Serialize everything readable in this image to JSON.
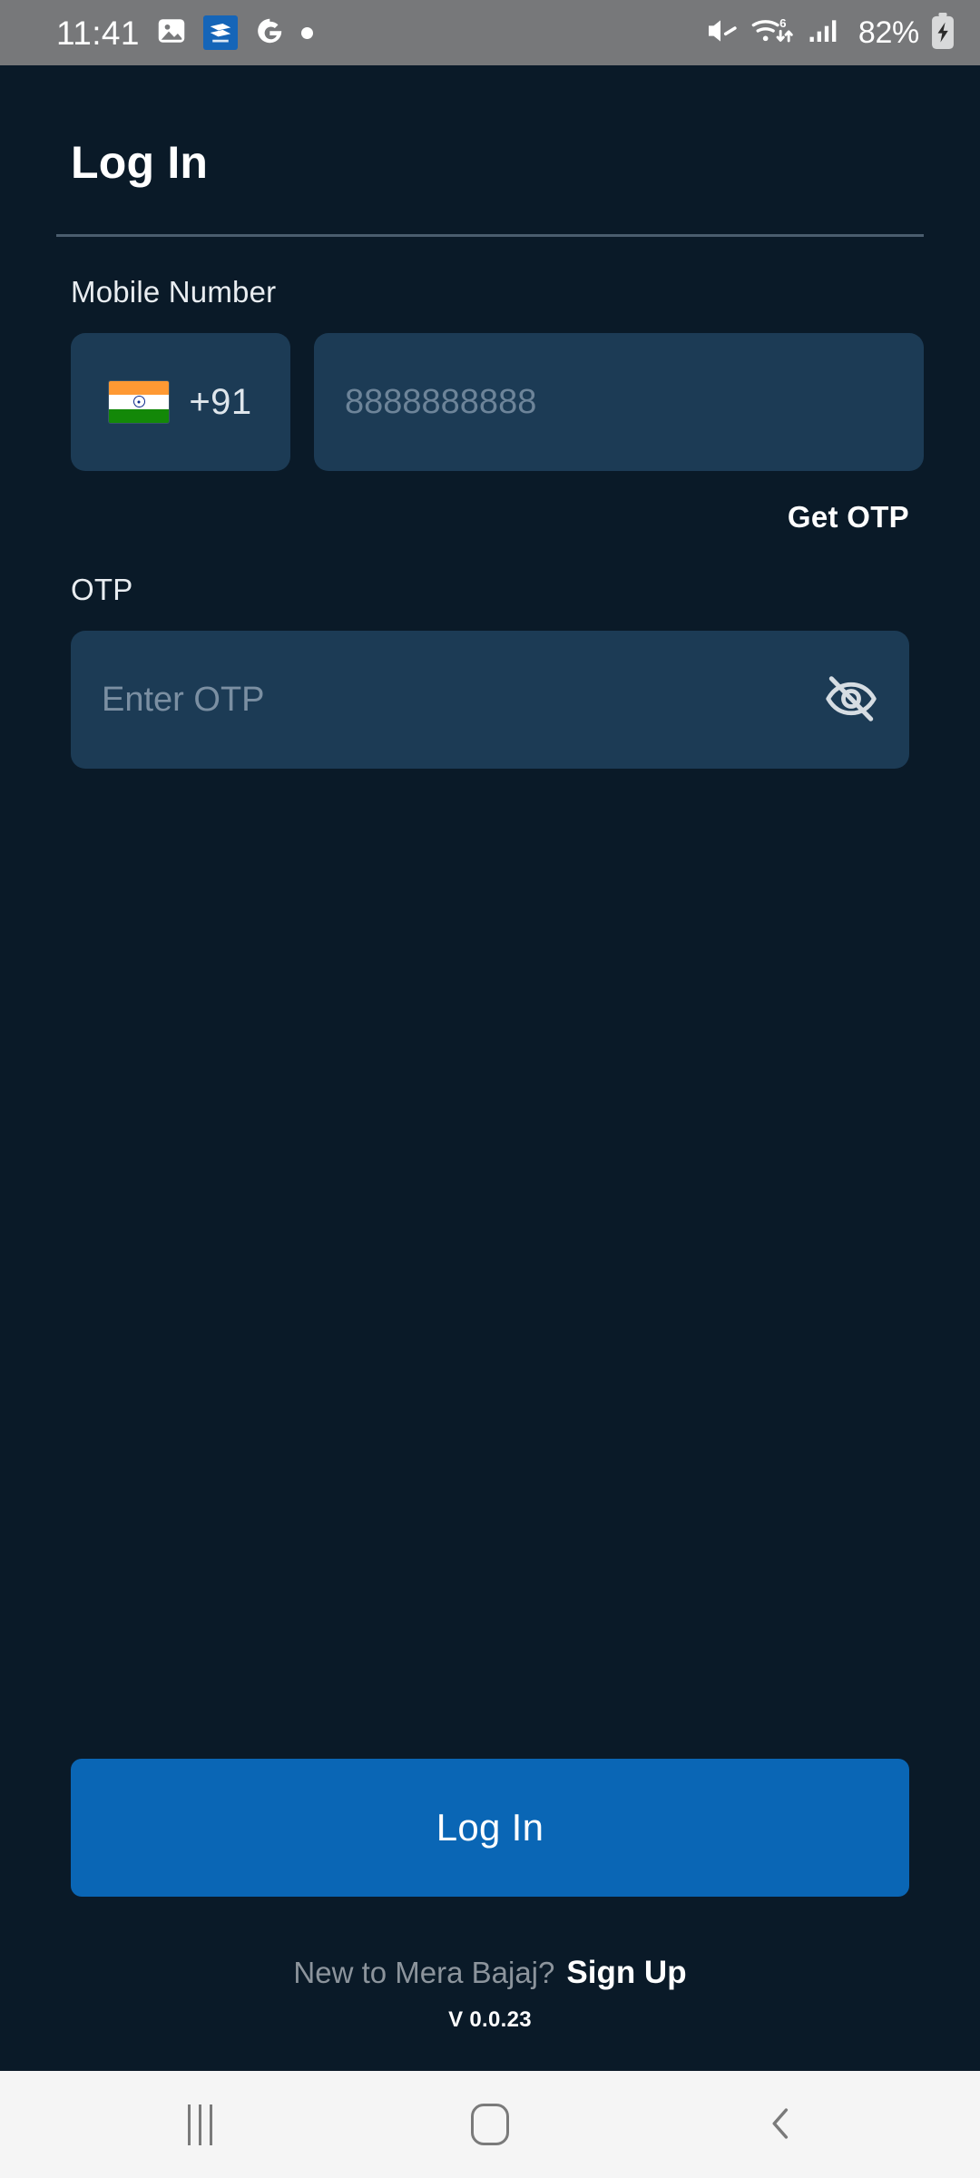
{
  "status_bar": {
    "time": "11:41",
    "icons_left": [
      "gallery-icon",
      "bajaj-app-icon",
      "google-icon",
      "dot-icon"
    ],
    "icons_right": [
      "mute-icon",
      "wifi-6-icon",
      "signal-icon",
      "battery-charging-icon"
    ],
    "battery_percent": "82%",
    "wifi_generation": "6",
    "background_color": "#77787a"
  },
  "screen": {
    "title": "Log In",
    "background_color": "#0a1a28"
  },
  "mobile_number": {
    "label": "Mobile Number",
    "country_code": "+91",
    "flag": "india-flag-icon",
    "input_value": "",
    "input_placeholder": "8888888888"
  },
  "get_otp": {
    "label": "Get OTP"
  },
  "otp": {
    "label": "OTP",
    "input_value": "",
    "input_placeholder": "Enter OTP",
    "visibility_icon": "eye-off-icon"
  },
  "primary_action": {
    "label": "Log In",
    "color": "#0a66b5"
  },
  "footer": {
    "signup_prompt": "New to Mera Bajaj?",
    "signup_link": "Sign Up",
    "version": "V 0.0.23"
  },
  "nav_bar": {
    "recents": "recents-icon",
    "home": "home-icon",
    "back": "back-icon",
    "background_color": "#f5f5f5"
  },
  "theme": {
    "field_background": "#1c3b55",
    "accent": "#0a66b5",
    "divider": "#4a5d6e",
    "muted_text": "#8c949c"
  }
}
